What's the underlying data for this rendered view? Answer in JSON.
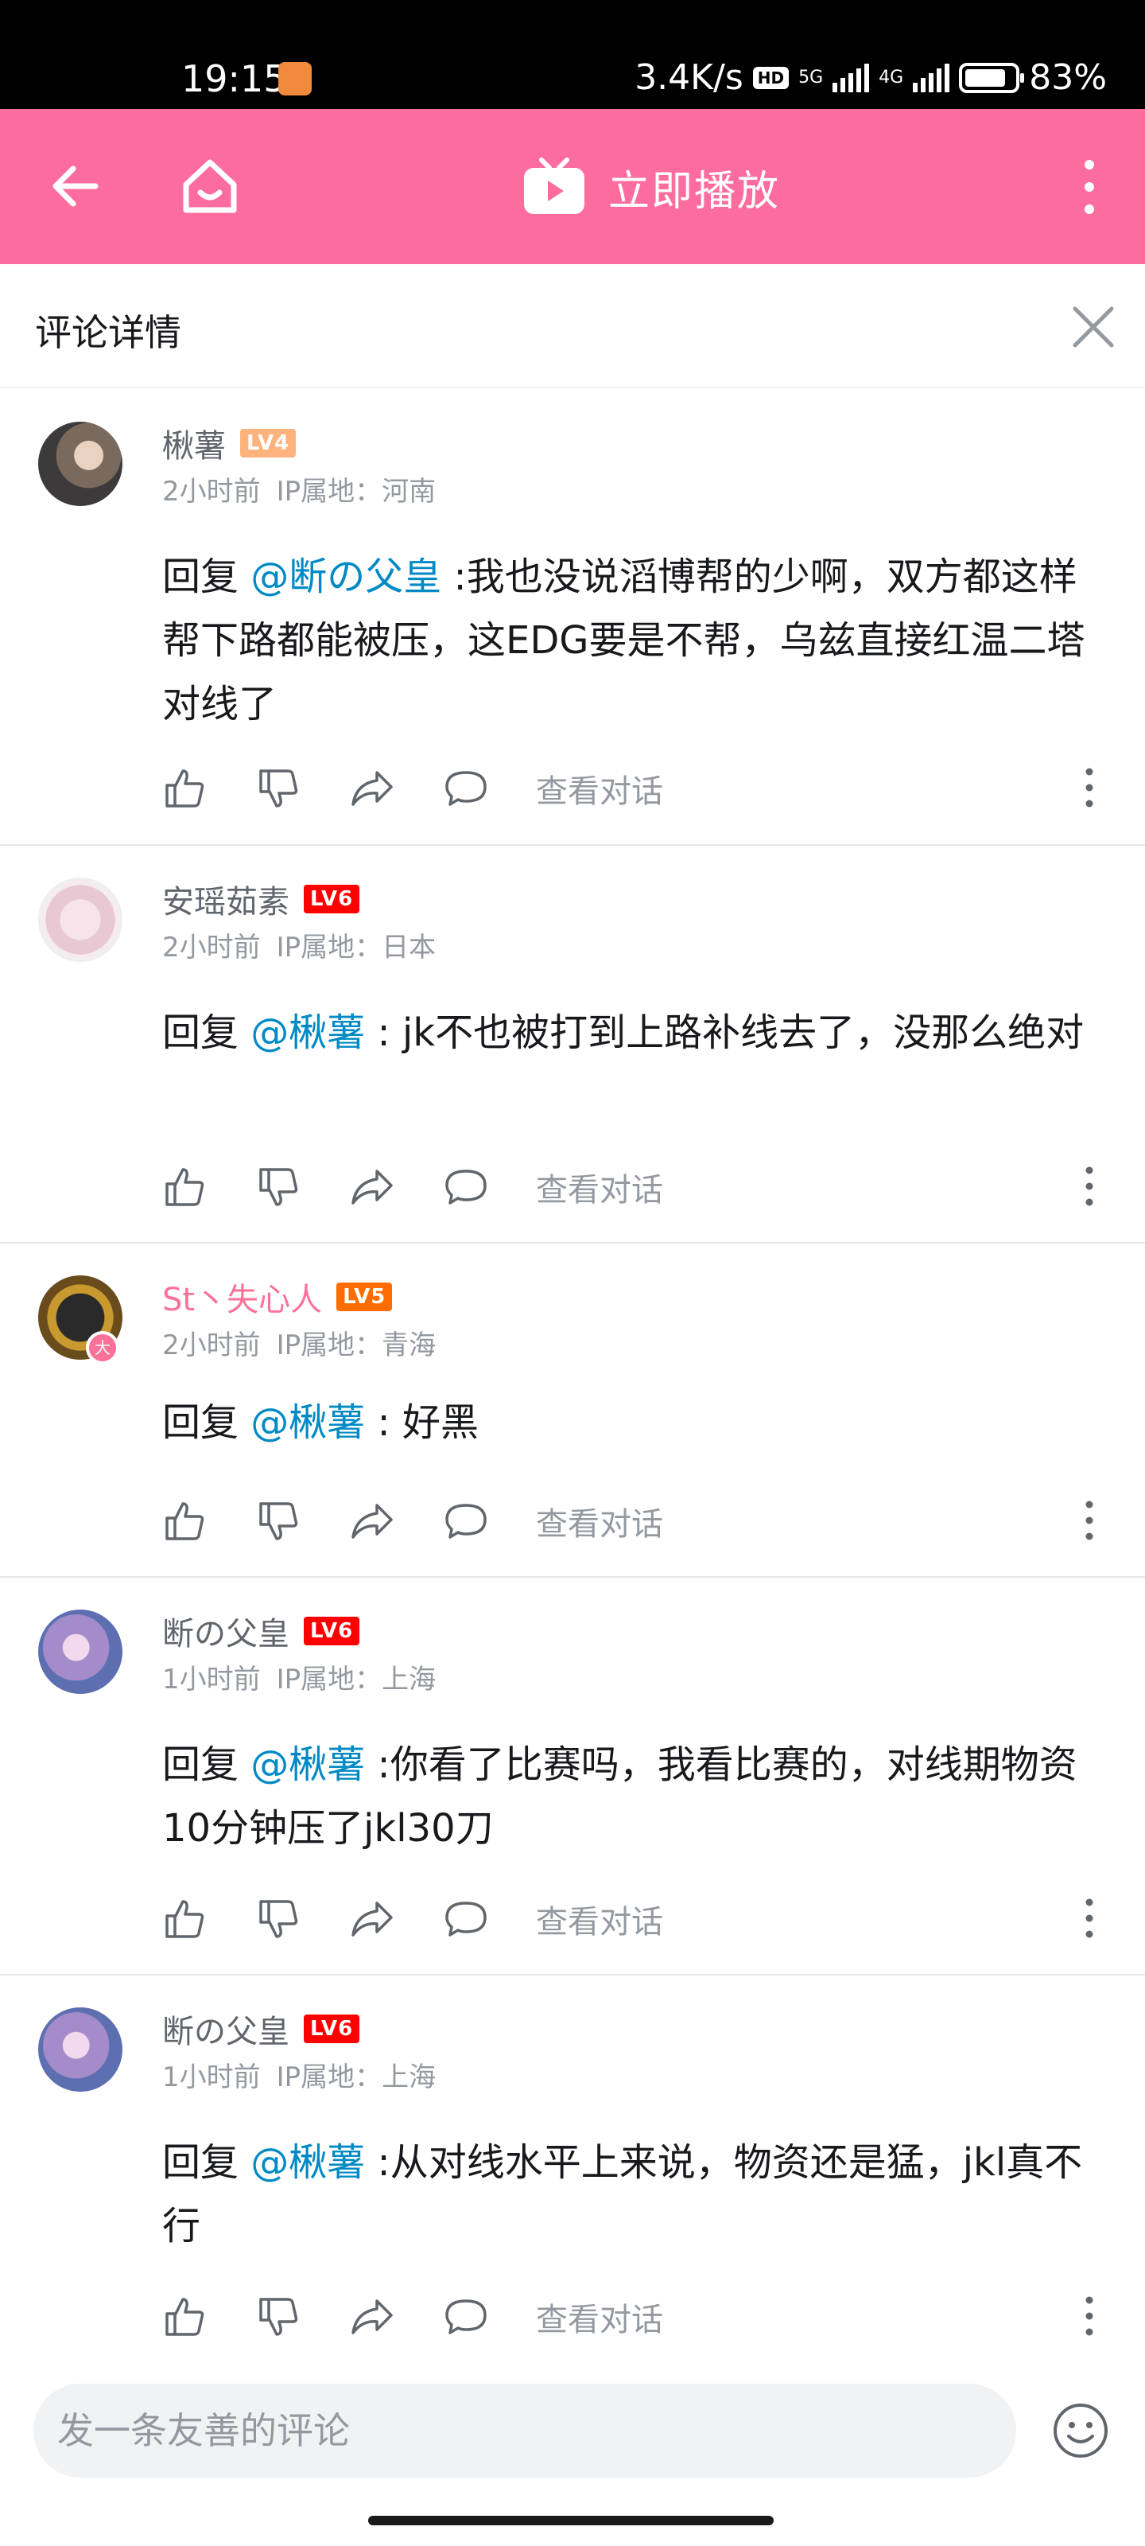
{
  "status_bar": {
    "time": "19:15",
    "network_speed": "3.4K/s",
    "hd": "HD",
    "net1": "5G",
    "net2": "4G",
    "battery": "83%",
    "battery_level": 0.83
  },
  "topbar": {
    "play_label": "立即播放",
    "bg_color": "#fd6c9e",
    "icons": [
      "arrow-left-icon",
      "home-icon",
      "tv-play-icon",
      "more-vertical-icon"
    ]
  },
  "header": {
    "title": "评论详情"
  },
  "comments": [
    {
      "username": "楸薯",
      "level": "LV4",
      "time": "2小时前",
      "ip": "IP属地：河南",
      "reply_prefix": "回复 ",
      "mention": "@断の父皇",
      "text": " :我也没说滔博帮的少啊，双方都这样帮下路都能被压，这EDG要是不帮，乌兹直接红温二塔对线了",
      "view_dialog": "查看对话"
    },
    {
      "username": "安瑶茹素",
      "level": "LV6",
      "time": "2小时前",
      "ip": "IP属地：日本",
      "reply_prefix": "回复 ",
      "mention": "@楸薯",
      "text": " : jk不也被打到上路补线去了，没那么绝对",
      "view_dialog": "查看对话"
    },
    {
      "username": "St丶失心人",
      "level": "LV5",
      "time": "2小时前",
      "ip": "IP属地：青海",
      "reply_prefix": "回复 ",
      "mention": "@楸薯",
      "text": " : 好黑",
      "view_dialog": "查看对话",
      "badge": "大"
    },
    {
      "username": "断の父皇",
      "level": "LV6",
      "time": "1小时前",
      "ip": "IP属地：上海",
      "reply_prefix": "回复 ",
      "mention": "@楸薯",
      "text": " :你看了比赛吗，我看比赛的，对线期物资10分钟压了jkl30刀",
      "view_dialog": "查看对话"
    },
    {
      "username": "断の父皇",
      "level": "LV6",
      "time": "1小时前",
      "ip": "IP属地：上海",
      "reply_prefix": "回复 ",
      "mention": "@楸薯",
      "text": " :从对线水平上来说，物资还是猛，jkl真不行",
      "view_dialog": "查看对话"
    }
  ],
  "input": {
    "placeholder": "发一条友善的评论"
  }
}
